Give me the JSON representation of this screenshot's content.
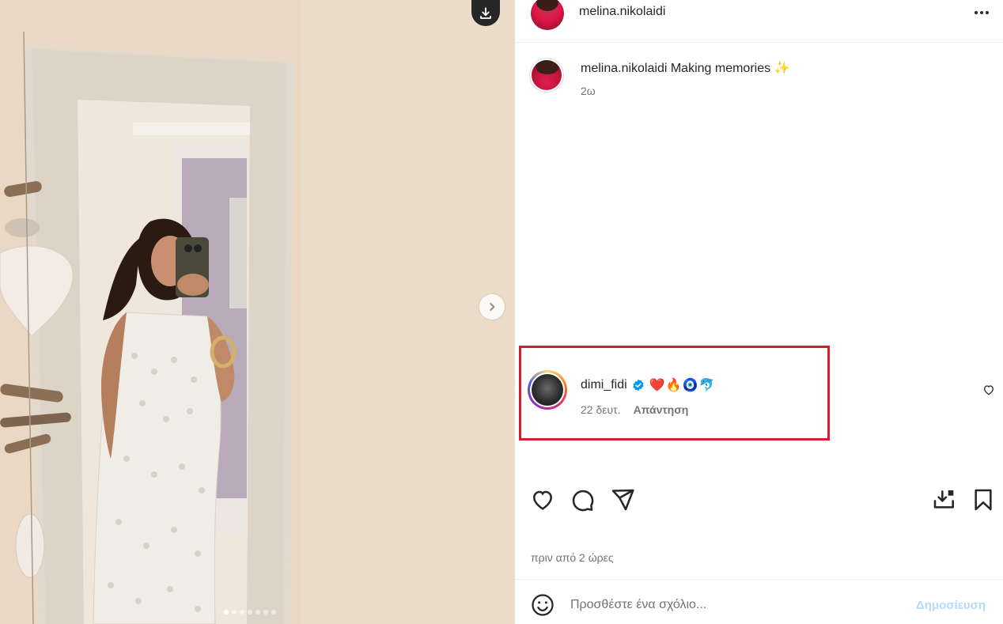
{
  "media": {
    "download_icon": "download-icon",
    "next_icon": "chevron-right-icon",
    "carousel_count": 7,
    "carousel_active_index": 0
  },
  "header": {
    "username": "melina.nikolaidi",
    "more_icon": "more-horizontal-icon"
  },
  "caption": {
    "username": "melina.nikolaidi",
    "text": "Making memories ✨",
    "time": "2ω"
  },
  "comment": {
    "username": "dimi_fidi",
    "verified": true,
    "text": "❤️🔥🧿🐬",
    "time": "22 δευτ.",
    "reply_label": "Απάντηση",
    "highlight_color": "#d0202e"
  },
  "actions": {
    "like_icon": "heart-icon",
    "comment_icon": "comment-icon",
    "share_icon": "send-icon",
    "download_icon": "download-tray-icon",
    "save_icon": "bookmark-icon"
  },
  "post_time": "πριν από 2 ώρες",
  "add_comment": {
    "placeholder": "Προσθέστε ένα σχόλιο...",
    "post_label": "Δημοσίευση",
    "post_color": "#b3dbff"
  }
}
